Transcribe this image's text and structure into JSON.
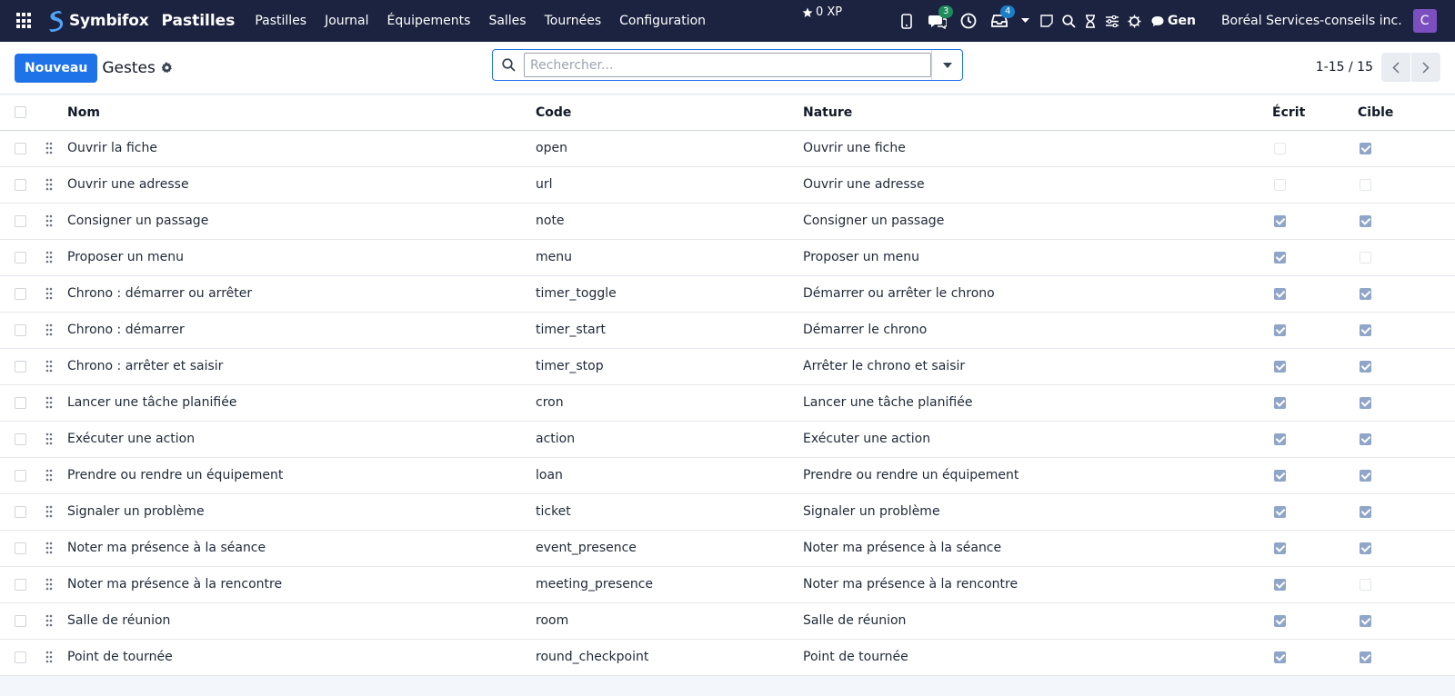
{
  "navbar": {
    "brand": "Symbifox",
    "app_name": "Pastilles",
    "menu": [
      "Pastilles",
      "Journal",
      "Équipements",
      "Salles",
      "Tournées",
      "Configuration"
    ],
    "xp": "0 XP",
    "messages_count": "3",
    "activities_count": "4",
    "gen_label": "Gen",
    "company": "Boréal Services-conseils inc.",
    "avatar_initial": "C"
  },
  "control_panel": {
    "new_button": "Nouveau",
    "title": "Gestes",
    "search_placeholder": "Rechercher...",
    "pager_value": "1-15 / 15"
  },
  "table": {
    "headers": {
      "name": "Nom",
      "code": "Code",
      "nature": "Nature",
      "written": "Écrit",
      "target": "Cible"
    },
    "rows": [
      {
        "name": "Ouvrir la fiche",
        "code": "open",
        "nature": "Ouvrir une fiche",
        "written": false,
        "target": true
      },
      {
        "name": "Ouvrir une adresse",
        "code": "url",
        "nature": "Ouvrir une adresse",
        "written": false,
        "target": false
      },
      {
        "name": "Consigner un passage",
        "code": "note",
        "nature": "Consigner un passage",
        "written": true,
        "target": true
      },
      {
        "name": "Proposer un menu",
        "code": "menu",
        "nature": "Proposer un menu",
        "written": true,
        "target": false
      },
      {
        "name": "Chrono : démarrer ou arrêter",
        "code": "timer_toggle",
        "nature": "Démarrer ou arrêter le chrono",
        "written": true,
        "target": true
      },
      {
        "name": "Chrono : démarrer",
        "code": "timer_start",
        "nature": "Démarrer le chrono",
        "written": true,
        "target": true
      },
      {
        "name": "Chrono : arrêter et saisir",
        "code": "timer_stop",
        "nature": "Arrêter le chrono et saisir",
        "written": true,
        "target": true
      },
      {
        "name": "Lancer une tâche planifiée",
        "code": "cron",
        "nature": "Lancer une tâche planifiée",
        "written": true,
        "target": true
      },
      {
        "name": "Exécuter une action",
        "code": "action",
        "nature": "Exécuter une action",
        "written": true,
        "target": true
      },
      {
        "name": "Prendre ou rendre un équipement",
        "code": "loan",
        "nature": "Prendre ou rendre un équipement",
        "written": true,
        "target": true
      },
      {
        "name": "Signaler un problème",
        "code": "ticket",
        "nature": "Signaler un problème",
        "written": true,
        "target": true
      },
      {
        "name": "Noter ma présence à la séance",
        "code": "event_presence",
        "nature": "Noter ma présence à la séance",
        "written": true,
        "target": true
      },
      {
        "name": "Noter ma présence à la rencontre",
        "code": "meeting_presence",
        "nature": "Noter ma présence à la rencontre",
        "written": true,
        "target": false
      },
      {
        "name": "Salle de réunion",
        "code": "room",
        "nature": "Salle de réunion",
        "written": true,
        "target": true
      },
      {
        "name": "Point de tournée",
        "code": "round_checkpoint",
        "nature": "Point de tournée",
        "written": true,
        "target": true
      }
    ]
  }
}
